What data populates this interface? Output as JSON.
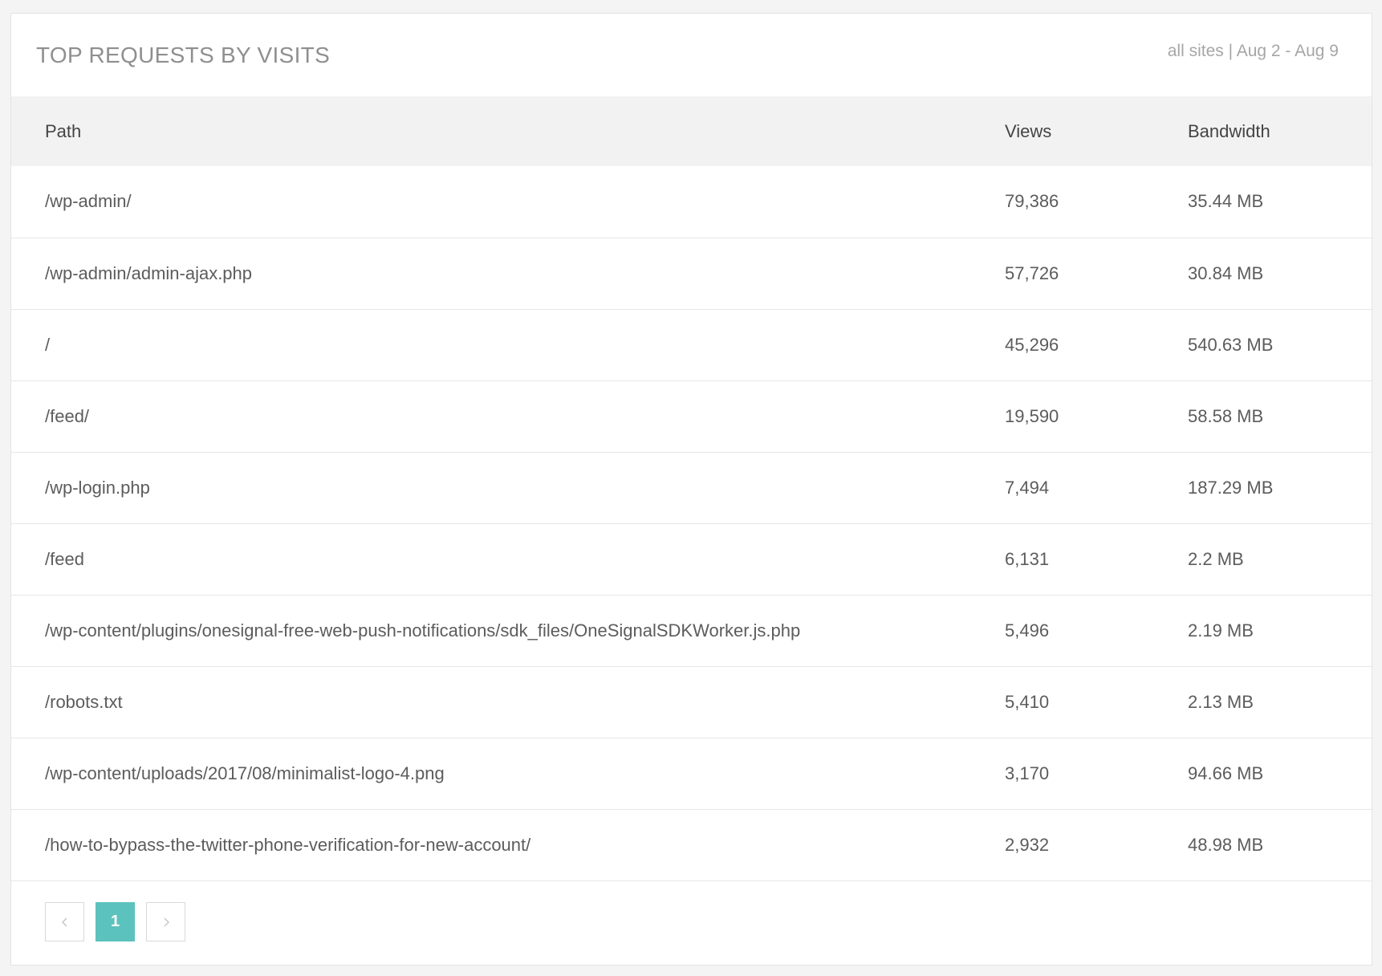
{
  "card": {
    "title": "TOP REQUESTS BY VISITS",
    "meta": "all sites | Aug 2 - Aug 9"
  },
  "table": {
    "headers": {
      "path": "Path",
      "views": "Views",
      "bandwidth": "Bandwidth"
    },
    "rows": [
      {
        "path": "/wp-admin/",
        "views": "79,386",
        "bandwidth": "35.44 MB"
      },
      {
        "path": "/wp-admin/admin-ajax.php",
        "views": "57,726",
        "bandwidth": "30.84 MB"
      },
      {
        "path": "/",
        "views": "45,296",
        "bandwidth": "540.63 MB"
      },
      {
        "path": "/feed/",
        "views": "19,590",
        "bandwidth": "58.58 MB"
      },
      {
        "path": "/wp-login.php",
        "views": "7,494",
        "bandwidth": "187.29 MB"
      },
      {
        "path": "/feed",
        "views": "6,131",
        "bandwidth": "2.2 MB"
      },
      {
        "path": "/wp-content/plugins/onesignal-free-web-push-notifications/sdk_files/OneSignalSDKWorker.js.php",
        "views": "5,496",
        "bandwidth": "2.19 MB"
      },
      {
        "path": "/robots.txt",
        "views": "5,410",
        "bandwidth": "2.13 MB"
      },
      {
        "path": "/wp-content/uploads/2017/08/minimalist-logo-4.png",
        "views": "3,170",
        "bandwidth": "94.66 MB"
      },
      {
        "path": "/how-to-bypass-the-twitter-phone-verification-for-new-account/",
        "views": "2,932",
        "bandwidth": "48.98 MB"
      }
    ]
  },
  "pagination": {
    "prev_icon": "chevron-left-icon",
    "current_page": "1",
    "next_icon": "chevron-right-icon",
    "active_color": "#5cc2bd"
  }
}
